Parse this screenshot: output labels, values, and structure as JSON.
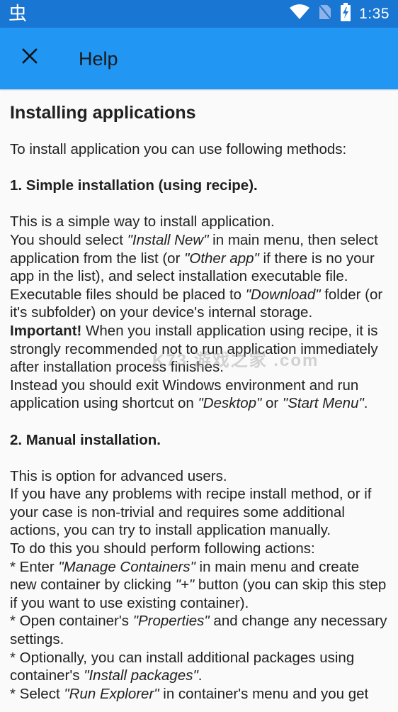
{
  "status_bar": {
    "app_icon": "bug-glyph-icon",
    "app_glyph": "虫",
    "icons": [
      "wifi-icon",
      "no-sim-icon",
      "battery-charging-icon"
    ],
    "time": "1:35"
  },
  "app_bar": {
    "close_icon": "close-icon",
    "title": "Help"
  },
  "colors": {
    "status_bar": "#1976d2",
    "app_bar": "#2196f3",
    "background": "#fafafa",
    "text": "#222222"
  },
  "content": {
    "title": "Installing applications",
    "intro": "To install application you can use following methods:",
    "section1": {
      "heading": "1. Simple installation (using recipe).",
      "lines": {
        "l1": "This is a simple way to install application.",
        "l2a": "You should select ",
        "l2i": "\"Install New\"",
        "l2b": " in main menu, then select application from the list (or ",
        "l2i2": "\"Other app\"",
        "l2c": " if there is no your app in the list), and select installation executable file.",
        "l3a": "Executable files should be placed to ",
        "l3i": "\"Download\"",
        "l3b": " folder (or it's subfolder) on your device's internal storage.",
        "l4b": "Important!",
        "l4a": " When you install application using recipe, it is strongly recommended not to run application immediately after installation process finishes.",
        "l5a": "Instead you should exit Windows environment and run application using shortcut on ",
        "l5i": "\"Desktop\"",
        "l5b": " or ",
        "l5i2": "\"Start Menu\"",
        "l5c": "."
      }
    },
    "section2": {
      "heading": "2. Manual installation.",
      "lines": {
        "l1": "This is option for advanced users.",
        "l2": "If you have any problems with recipe install method, or if your case is non-trivial and requires some additional actions, you can try to install application manually.",
        "l3": "To do this you should perform following actions:",
        "s1a": "* Enter ",
        "s1i": "\"Manage Containers\"",
        "s1b": " in main menu and create new container by clicking ",
        "s1i2": "\"+\"",
        "s1c": " button (you can skip this step if you want to use existing container).",
        "s2a": "* Open container's ",
        "s2i": "\"Properties\"",
        "s2b": " and change any necessary settings.",
        "s3a": "* Optionally, you can install additional packages using container's ",
        "s3i": "\"Install packages\"",
        "s3b": ".",
        "s4a": "* Select ",
        "s4i": "\"Run Explorer\"",
        "s4b": " in container's menu and you get"
      }
    }
  },
  "watermark": "K73 游戏之家 .com"
}
